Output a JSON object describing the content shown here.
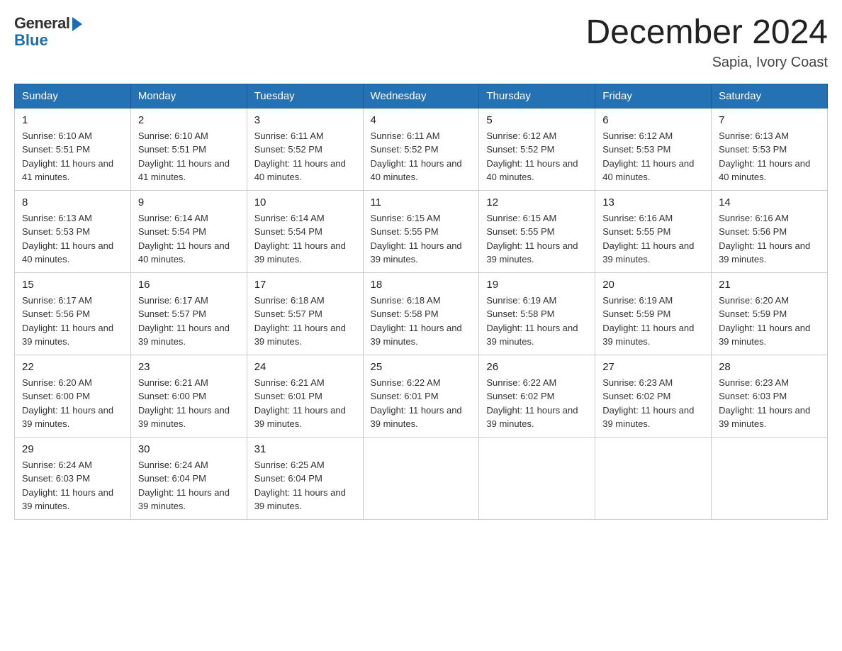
{
  "header": {
    "logo_general": "General",
    "logo_blue": "Blue",
    "month_title": "December 2024",
    "location": "Sapia, Ivory Coast"
  },
  "days_of_week": [
    "Sunday",
    "Monday",
    "Tuesday",
    "Wednesday",
    "Thursday",
    "Friday",
    "Saturday"
  ],
  "weeks": [
    [
      {
        "day": "1",
        "sunrise": "6:10 AM",
        "sunset": "5:51 PM",
        "daylight": "11 hours and 41 minutes."
      },
      {
        "day": "2",
        "sunrise": "6:10 AM",
        "sunset": "5:51 PM",
        "daylight": "11 hours and 41 minutes."
      },
      {
        "day": "3",
        "sunrise": "6:11 AM",
        "sunset": "5:52 PM",
        "daylight": "11 hours and 40 minutes."
      },
      {
        "day": "4",
        "sunrise": "6:11 AM",
        "sunset": "5:52 PM",
        "daylight": "11 hours and 40 minutes."
      },
      {
        "day": "5",
        "sunrise": "6:12 AM",
        "sunset": "5:52 PM",
        "daylight": "11 hours and 40 minutes."
      },
      {
        "day": "6",
        "sunrise": "6:12 AM",
        "sunset": "5:53 PM",
        "daylight": "11 hours and 40 minutes."
      },
      {
        "day": "7",
        "sunrise": "6:13 AM",
        "sunset": "5:53 PM",
        "daylight": "11 hours and 40 minutes."
      }
    ],
    [
      {
        "day": "8",
        "sunrise": "6:13 AM",
        "sunset": "5:53 PM",
        "daylight": "11 hours and 40 minutes."
      },
      {
        "day": "9",
        "sunrise": "6:14 AM",
        "sunset": "5:54 PM",
        "daylight": "11 hours and 40 minutes."
      },
      {
        "day": "10",
        "sunrise": "6:14 AM",
        "sunset": "5:54 PM",
        "daylight": "11 hours and 39 minutes."
      },
      {
        "day": "11",
        "sunrise": "6:15 AM",
        "sunset": "5:55 PM",
        "daylight": "11 hours and 39 minutes."
      },
      {
        "day": "12",
        "sunrise": "6:15 AM",
        "sunset": "5:55 PM",
        "daylight": "11 hours and 39 minutes."
      },
      {
        "day": "13",
        "sunrise": "6:16 AM",
        "sunset": "5:55 PM",
        "daylight": "11 hours and 39 minutes."
      },
      {
        "day": "14",
        "sunrise": "6:16 AM",
        "sunset": "5:56 PM",
        "daylight": "11 hours and 39 minutes."
      }
    ],
    [
      {
        "day": "15",
        "sunrise": "6:17 AM",
        "sunset": "5:56 PM",
        "daylight": "11 hours and 39 minutes."
      },
      {
        "day": "16",
        "sunrise": "6:17 AM",
        "sunset": "5:57 PM",
        "daylight": "11 hours and 39 minutes."
      },
      {
        "day": "17",
        "sunrise": "6:18 AM",
        "sunset": "5:57 PM",
        "daylight": "11 hours and 39 minutes."
      },
      {
        "day": "18",
        "sunrise": "6:18 AM",
        "sunset": "5:58 PM",
        "daylight": "11 hours and 39 minutes."
      },
      {
        "day": "19",
        "sunrise": "6:19 AM",
        "sunset": "5:58 PM",
        "daylight": "11 hours and 39 minutes."
      },
      {
        "day": "20",
        "sunrise": "6:19 AM",
        "sunset": "5:59 PM",
        "daylight": "11 hours and 39 minutes."
      },
      {
        "day": "21",
        "sunrise": "6:20 AM",
        "sunset": "5:59 PM",
        "daylight": "11 hours and 39 minutes."
      }
    ],
    [
      {
        "day": "22",
        "sunrise": "6:20 AM",
        "sunset": "6:00 PM",
        "daylight": "11 hours and 39 minutes."
      },
      {
        "day": "23",
        "sunrise": "6:21 AM",
        "sunset": "6:00 PM",
        "daylight": "11 hours and 39 minutes."
      },
      {
        "day": "24",
        "sunrise": "6:21 AM",
        "sunset": "6:01 PM",
        "daylight": "11 hours and 39 minutes."
      },
      {
        "day": "25",
        "sunrise": "6:22 AM",
        "sunset": "6:01 PM",
        "daylight": "11 hours and 39 minutes."
      },
      {
        "day": "26",
        "sunrise": "6:22 AM",
        "sunset": "6:02 PM",
        "daylight": "11 hours and 39 minutes."
      },
      {
        "day": "27",
        "sunrise": "6:23 AM",
        "sunset": "6:02 PM",
        "daylight": "11 hours and 39 minutes."
      },
      {
        "day": "28",
        "sunrise": "6:23 AM",
        "sunset": "6:03 PM",
        "daylight": "11 hours and 39 minutes."
      }
    ],
    [
      {
        "day": "29",
        "sunrise": "6:24 AM",
        "sunset": "6:03 PM",
        "daylight": "11 hours and 39 minutes."
      },
      {
        "day": "30",
        "sunrise": "6:24 AM",
        "sunset": "6:04 PM",
        "daylight": "11 hours and 39 minutes."
      },
      {
        "day": "31",
        "sunrise": "6:25 AM",
        "sunset": "6:04 PM",
        "daylight": "11 hours and 39 minutes."
      },
      null,
      null,
      null,
      null
    ]
  ]
}
